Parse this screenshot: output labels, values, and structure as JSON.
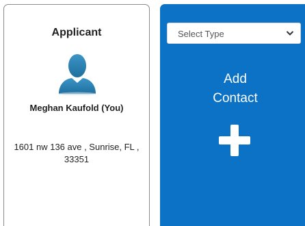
{
  "applicant": {
    "title": "Applicant",
    "name": "Meghan Kaufold (You)",
    "address": "1601 nw 136 ave , Sunrise, FL , 33351",
    "avatar_icon": "user-silhouette-icon"
  },
  "add_contact": {
    "select_placeholder": "Select Type",
    "label": "Add\nContact",
    "plus_icon": "plus-icon",
    "chevron_icon": "chevron-down-icon"
  },
  "colors": {
    "accent_blue": "#0b72c6",
    "avatar_blue": "#2e86b8",
    "card_border": "#8a8a8a"
  }
}
